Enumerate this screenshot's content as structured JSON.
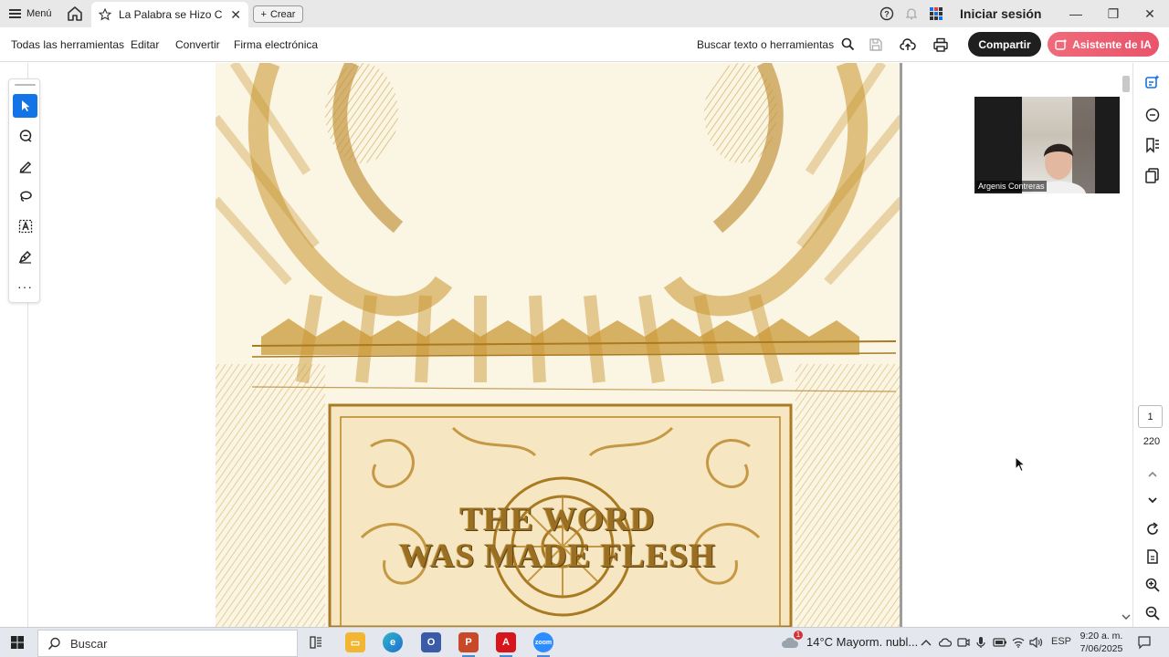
{
  "titlebar": {
    "menu_label": "Menú",
    "tab_title": "La Palabra se Hizo C...",
    "new_tab_label": "Crear",
    "signin_label": "Iniciar sesión"
  },
  "toolbar": {
    "all_tools": "Todas las herramientas",
    "edit": "Editar",
    "convert": "Convertir",
    "esign": "Firma electrónica",
    "search_tools": "Buscar texto o herramientas",
    "share": "Compartir",
    "ai_assistant": "Asistente de IA"
  },
  "document": {
    "title_line1": "THE WORD",
    "title_line2": "WAS MADE FLESH"
  },
  "pagination": {
    "current_page": "1",
    "total_pages": "220"
  },
  "video": {
    "participant_name": "Argenis Contreras"
  },
  "taskbar": {
    "search_label": "Buscar",
    "weather": "14°C  Mayorm. nubl...",
    "language": "ESP",
    "time": "9:20 a. m.",
    "date": "7/06/2025",
    "weather_alert": "1"
  },
  "colors": {
    "accent": "#1473e6",
    "share_bg": "#1f1f1f",
    "ai_bg": "#e9546b",
    "page_tint": "#c8942c"
  }
}
